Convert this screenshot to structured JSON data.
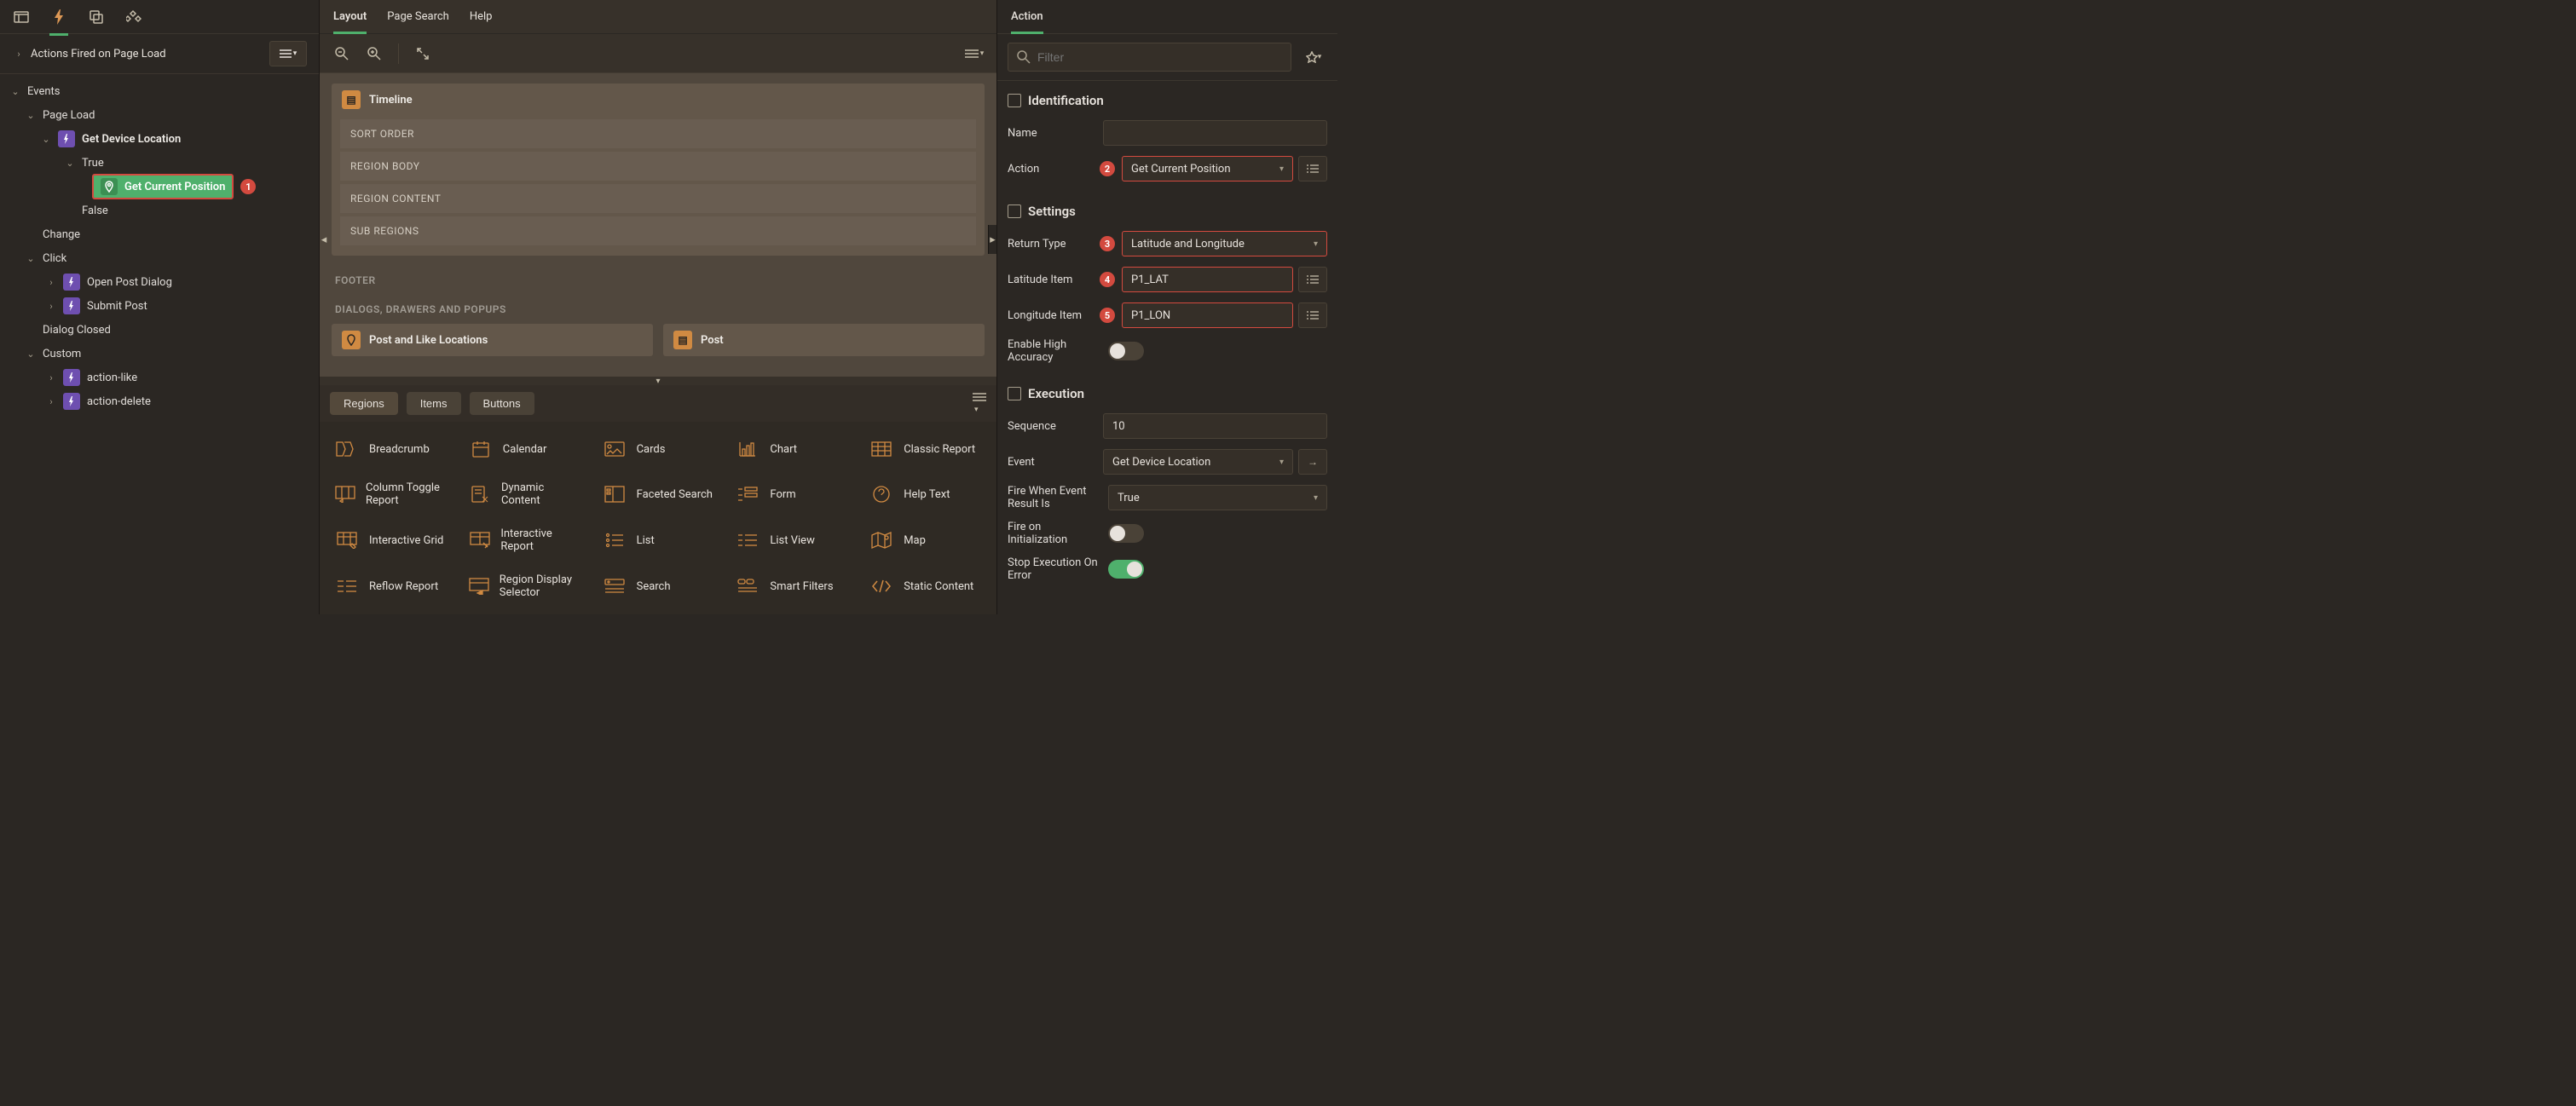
{
  "left": {
    "header_title": "Actions Fired on Page Load",
    "tree": {
      "events": "Events",
      "page_load": "Page Load",
      "get_device_location": "Get Device Location",
      "true": "True",
      "get_current_position": "Get Current Position",
      "badge1": "1",
      "false": "False",
      "change": "Change",
      "click": "Click",
      "open_post_dialog": "Open Post Dialog",
      "submit_post": "Submit Post",
      "dialog_closed": "Dialog Closed",
      "custom": "Custom",
      "action_like": "action-like",
      "action_delete": "action-delete"
    }
  },
  "center": {
    "tabs": {
      "layout": "Layout",
      "page_search": "Page Search",
      "help": "Help"
    },
    "regions": {
      "timeline": "Timeline",
      "sort_order": "SORT ORDER",
      "region_body": "REGION BODY",
      "region_content": "REGION CONTENT",
      "sub_regions": "SUB REGIONS",
      "footer": "FOOTER",
      "dialogs": "DIALOGS, DRAWERS AND POPUPS",
      "post_like_locations": "Post and Like Locations",
      "post": "Post"
    },
    "gallery_tabs": {
      "regions": "Regions",
      "items": "Items",
      "buttons": "Buttons"
    },
    "gallery": {
      "breadcrumb": "Breadcrumb",
      "calendar": "Calendar",
      "cards": "Cards",
      "chart": "Chart",
      "classic": "Classic Report",
      "coltoggle": "Column Toggle Report",
      "dyncontent": "Dynamic Content",
      "faceted": "Faceted Search",
      "form": "Form",
      "helptext": "Help Text",
      "igrid": "Interactive Grid",
      "ireport": "Interactive Report",
      "list": "List",
      "listview": "List View",
      "map": "Map",
      "reflow": "Reflow Report",
      "rds": "Region Display Selector",
      "search": "Search",
      "smart": "Smart Filters",
      "static": "Static Content"
    }
  },
  "right": {
    "tab": "Action",
    "filter_placeholder": "Filter",
    "sections": {
      "identification": "Identification",
      "settings": "Settings",
      "execution": "Execution"
    },
    "fields": {
      "name": {
        "label": "Name",
        "value": ""
      },
      "action": {
        "label": "Action",
        "value": "Get Current Position",
        "badge": "2"
      },
      "return_type": {
        "label": "Return Type",
        "value": "Latitude and Longitude",
        "badge": "3"
      },
      "lat_item": {
        "label": "Latitude Item",
        "value": "P1_LAT",
        "badge": "4"
      },
      "lon_item": {
        "label": "Longitude Item",
        "value": "P1_LON",
        "badge": "5"
      },
      "enable_high_accuracy": {
        "label": "Enable High Accuracy"
      },
      "sequence": {
        "label": "Sequence",
        "value": "10"
      },
      "event": {
        "label": "Event",
        "value": "Get Device Location"
      },
      "fire_when": {
        "label": "Fire When Event Result Is",
        "value": "True"
      },
      "fire_init": {
        "label": "Fire on Initialization"
      },
      "stop_exec": {
        "label": "Stop Execution On Error"
      }
    }
  }
}
